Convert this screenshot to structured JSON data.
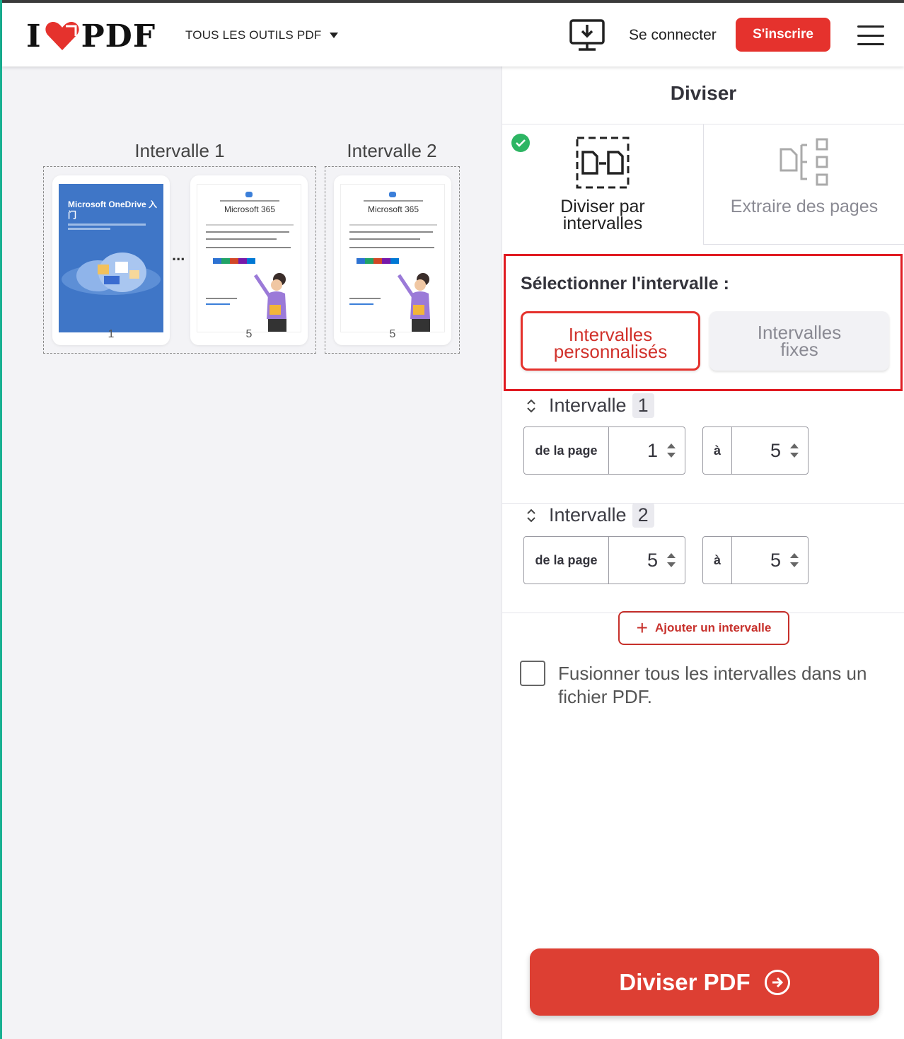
{
  "header": {
    "logo_left": "I",
    "logo_right": "PDF",
    "tools_menu": "TOUS LES OUTILS PDF",
    "login": "Se connecter",
    "signup": "S'inscrire"
  },
  "workspace": {
    "groups": [
      {
        "label": "Intervalle 1",
        "pages": [
          {
            "number": "1",
            "title": "Microsoft OneDrive 入门",
            "style": "cover"
          },
          {
            "number": "5",
            "title": "Microsoft 365",
            "style": "content"
          }
        ]
      },
      {
        "label": "Intervalle 2",
        "pages": [
          {
            "number": "5",
            "title": "Microsoft 365",
            "style": "content"
          }
        ]
      }
    ],
    "ellipsis": "..."
  },
  "panel": {
    "title": "Diviser",
    "modes": [
      {
        "label_line1": "Diviser par",
        "label_line2": "intervalles",
        "active": true
      },
      {
        "label_line1": "Extraire des pages",
        "active": false
      }
    ],
    "select_title": "Sélectionner l'intervalle :",
    "options": [
      {
        "line1": "Intervalles",
        "line2": "personnalisés",
        "selected": true
      },
      {
        "line1": "Intervalles",
        "line2": "fixes",
        "selected": false
      }
    ],
    "ranges": [
      {
        "label": "Intervalle",
        "index": "1",
        "from_label": "de la page",
        "from": "1",
        "to_label": "à",
        "to": "5"
      },
      {
        "label": "Intervalle",
        "index": "2",
        "from_label": "de la page",
        "from": "5",
        "to_label": "à",
        "to": "5"
      }
    ],
    "add_range": "Ajouter un intervalle",
    "merge_label": "Fusionner tous les intervalles dans un fichier PDF.",
    "merge_checked": false,
    "submit": "Diviser PDF"
  },
  "colors": {
    "brand_red": "#e5322d",
    "check_green": "#2db563",
    "highlight_red": "#e01b22",
    "cover_blue": "#3f76c7"
  }
}
